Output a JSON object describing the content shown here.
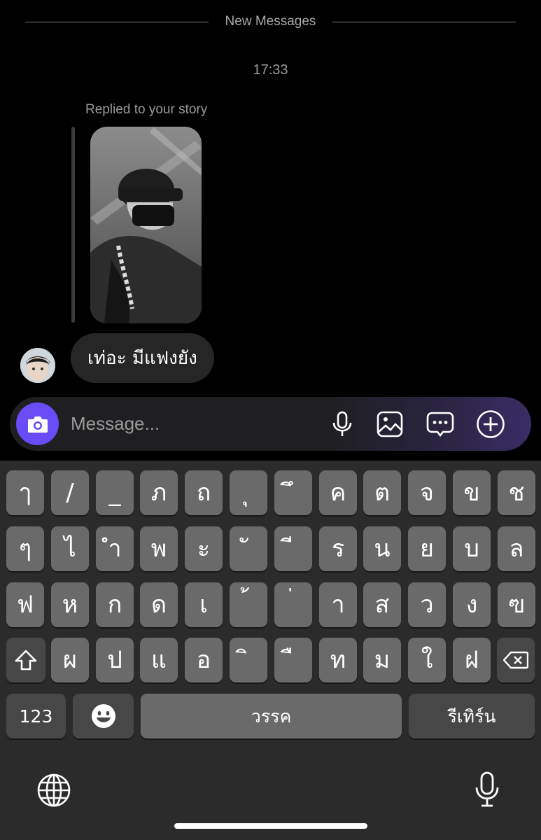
{
  "chat": {
    "divider_label": "New Messages",
    "timestamp": "17:33",
    "reply_caption": "Replied to your story",
    "message_text": "เท่อะ มีแฟงยัง"
  },
  "composer": {
    "placeholder": "Message...",
    "accent_color": "#6a4cf6",
    "icons": [
      "camera-icon",
      "microphone-icon",
      "gallery-icon",
      "sticker-chat-icon",
      "add-circle-icon"
    ]
  },
  "keyboard": {
    "rows": [
      [
        "ๅ",
        "/",
        "_",
        "ภ",
        "ถ",
        "ุ",
        "ึ",
        "ค",
        "ต",
        "จ",
        "ข",
        "ช"
      ],
      [
        "ๆ",
        "ไ",
        "ำ",
        "พ",
        "ะ",
        "ั",
        "ี",
        "ร",
        "น",
        "ย",
        "บ",
        "ล"
      ],
      [
        "ฟ",
        "ห",
        "ก",
        "ด",
        "เ",
        "้",
        "่",
        "า",
        "ส",
        "ว",
        "ง",
        "ฃ"
      ],
      [
        "ผ",
        "ป",
        "แ",
        "อ",
        "ิ",
        "ื",
        "ท",
        "ม",
        "ใ",
        "ฝ"
      ]
    ],
    "numbers_key": "123",
    "space_key": "วรรค",
    "return_key": "รีเทิร์น",
    "icons": [
      "shift-icon",
      "backspace-icon",
      "emoji-icon",
      "globe-icon",
      "dictation-icon"
    ]
  }
}
